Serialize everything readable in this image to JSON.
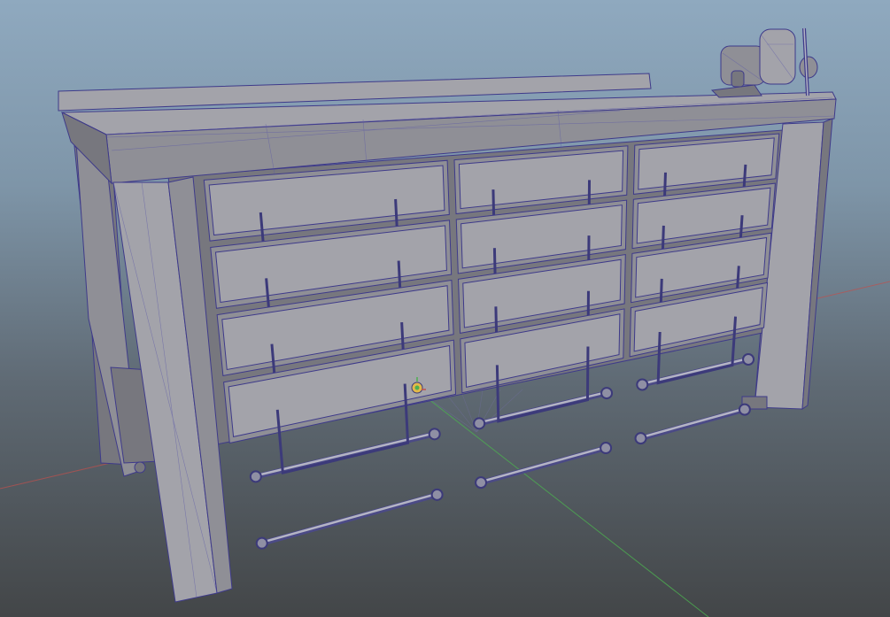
{
  "viewport": {
    "background_top": "#8fa9bf",
    "background_bottom": "#434648",
    "wire_color": "#3e3a8a",
    "grid_x_axis_color": "#c0504d",
    "grid_z_axis_color": "#4caf50"
  },
  "model": {
    "object": "workbench",
    "drawer_columns": 3,
    "drawer_rows": 4,
    "drawer_count": 12,
    "accessory": "bench-vise",
    "pivot_icon": "transform-pivot-gizmo-icon"
  }
}
